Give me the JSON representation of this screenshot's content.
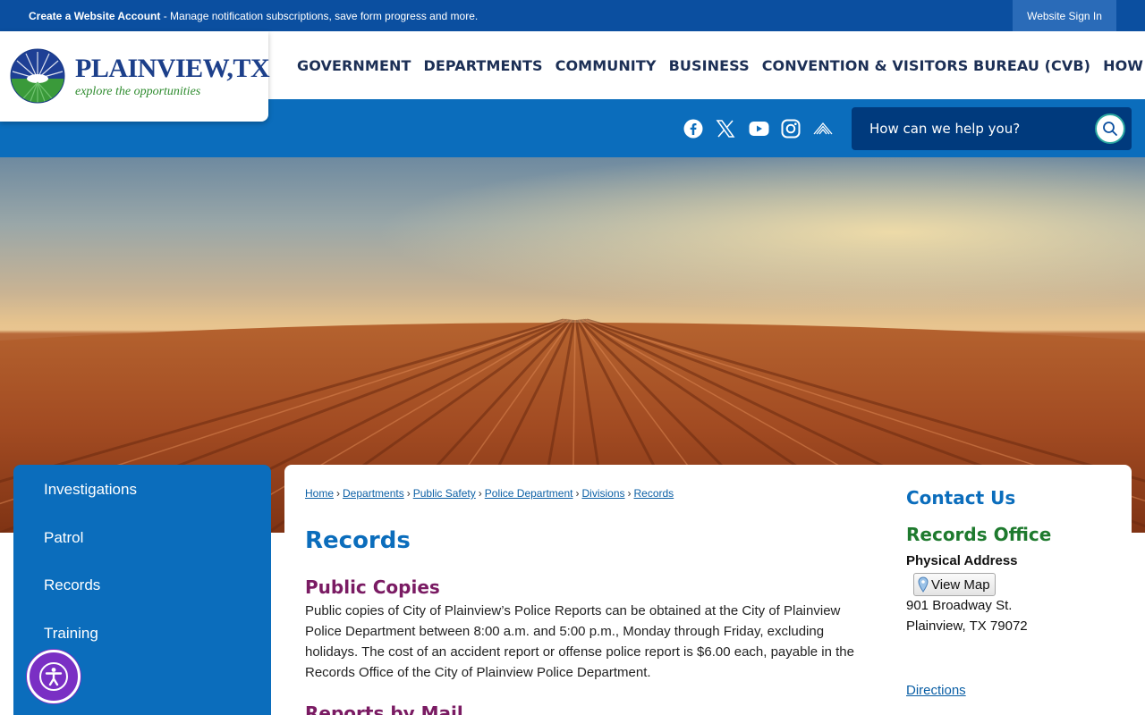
{
  "topbar": {
    "account_link": "Create a Website Account",
    "account_desc": " - Manage notification subscriptions, save form progress and more.",
    "sign_in": "Website Sign In"
  },
  "logo": {
    "title": "PLAINVIEW,TX",
    "tagline": "explore the opportunities"
  },
  "nav": {
    "items": [
      "GOVERNMENT",
      "DEPARTMENTS",
      "COMMUNITY",
      "BUSINESS",
      "CONVENTION & VISITORS BUREAU (CVB)",
      "HOW DO I..."
    ]
  },
  "social": {
    "icons": [
      "facebook-icon",
      "x-icon",
      "youtube-icon",
      "instagram-icon",
      "notify-icon"
    ]
  },
  "search": {
    "placeholder": "How can we help you?"
  },
  "sidebar": {
    "items": [
      {
        "label": "Investigations"
      },
      {
        "label": "Patrol"
      },
      {
        "label": "Records"
      },
      {
        "label": "Training"
      }
    ]
  },
  "breadcrumb": {
    "items": [
      "Home",
      "Departments",
      "Public Safety",
      "Police Department",
      "Divisions",
      "Records"
    ],
    "separator": "›"
  },
  "content": {
    "page_title": "Records",
    "section1_title": "Public Copies",
    "section1_body": "Public copies of City of Plainview’s Police Reports can be obtained at the City of Plainview Police Department between 8:00 a.m. and 5:00 p.m., Monday through Friday, excluding holidays. The cost of an accident report or offense police report is $6.00 each, payable in the Records Office of the City of Plainview Police Department.",
    "section2_title": "Reports by Mail"
  },
  "contact": {
    "title": "Contact Us",
    "office": "Records Office",
    "address_label": "Physical Address",
    "view_map": "View Map",
    "street": "901 Broadway St.",
    "city": "Plainview, TX 79072",
    "directions": "Directions"
  },
  "colors": {
    "top_bar": "#0b4fa0",
    "brand_blue": "#0b6dbc",
    "section_title": "#7a1b63",
    "office_green": "#1e7a2e",
    "accessibility": "#7a2fc4"
  }
}
